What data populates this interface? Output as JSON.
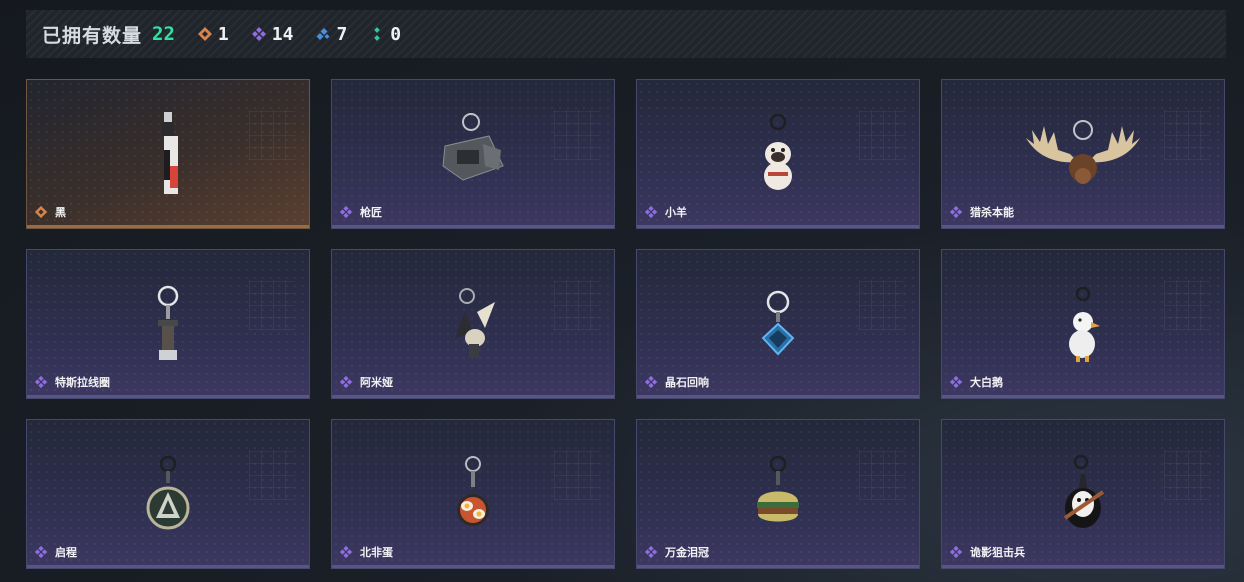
{
  "header": {
    "owned_label": "已拥有数量",
    "owned_count": "22",
    "stats": [
      {
        "icon": "orange-diamond-icon",
        "color": "#d5854a",
        "value": "1"
      },
      {
        "icon": "purple-diamond-icon",
        "color": "#8e6ee0",
        "value": "14"
      },
      {
        "icon": "blue-diamond-icon",
        "color": "#4a90d9",
        "value": "7"
      },
      {
        "icon": "green-dots-icon",
        "color": "#32c8a0",
        "value": "0"
      }
    ]
  },
  "colors": {
    "accent_green": "#34e0a1",
    "rarity_orange": "#d5854a",
    "rarity_purple": "#8e6ee0"
  },
  "items": [
    {
      "name": "黑",
      "rarity": "orange",
      "art": "black-tag-charm-icon"
    },
    {
      "name": "枪匠",
      "rarity": "purple",
      "art": "gunsmith-charm-icon"
    },
    {
      "name": "小羊",
      "rarity": "purple",
      "art": "little-sheep-charm-icon"
    },
    {
      "name": "猎杀本能",
      "rarity": "purple",
      "art": "moose-antler-charm-icon"
    },
    {
      "name": "特斯拉线圈",
      "rarity": "purple",
      "art": "tesla-coil-charm-icon"
    },
    {
      "name": "阿米娅",
      "rarity": "purple",
      "art": "amiya-charm-icon"
    },
    {
      "name": "晶石回响",
      "rarity": "purple",
      "art": "crystal-echo-charm-icon"
    },
    {
      "name": "大白鹅",
      "rarity": "purple",
      "art": "white-goose-charm-icon"
    },
    {
      "name": "启程",
      "rarity": "purple",
      "art": "departure-medal-charm-icon"
    },
    {
      "name": "北非蛋",
      "rarity": "purple",
      "art": "shakshuka-pan-charm-icon"
    },
    {
      "name": "万金泪冠",
      "rarity": "purple",
      "art": "golden-burger-charm-icon"
    },
    {
      "name": "诡影狙击兵",
      "rarity": "purple",
      "art": "phantom-sniper-charm-icon"
    }
  ]
}
